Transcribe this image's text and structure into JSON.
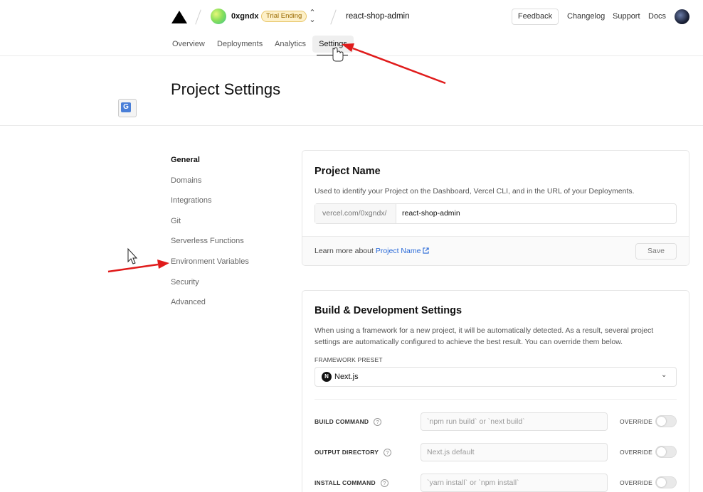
{
  "header": {
    "team_name": "0xgndx",
    "trial_badge": "Trial Ending",
    "switcher_icon": "chevron-up-down-icon",
    "project_name": "react-shop-admin",
    "feedback_label": "Feedback",
    "links": [
      "Changelog",
      "Support",
      "Docs"
    ]
  },
  "tabs": {
    "items": [
      "Overview",
      "Deployments",
      "Analytics",
      "Settings"
    ],
    "active": "Settings"
  },
  "page": {
    "title": "Project Settings"
  },
  "sidebar": {
    "items": [
      {
        "label": "General"
      },
      {
        "label": "Domains"
      },
      {
        "label": "Integrations"
      },
      {
        "label": "Git"
      },
      {
        "label": "Serverless Functions"
      },
      {
        "label": "Environment Variables"
      },
      {
        "label": "Security"
      },
      {
        "label": "Advanced"
      }
    ]
  },
  "project_name_card": {
    "title": "Project Name",
    "description": "Used to identify your Project on the Dashboard, Vercel CLI, and in the URL of your Deployments.",
    "url_prefix": "vercel.com/0xgndx/",
    "value": "react-shop-admin",
    "learn_prefix": "Learn more about",
    "learn_link": "Project Name",
    "save_label": "Save"
  },
  "build_card": {
    "title": "Build & Development Settings",
    "description_line1": "When using a framework for a new project, it will be automatically detected. As a result, several project",
    "description_line2": "settings are automatically configured to achieve the best result. You can override them below.",
    "framework_label": "FRAMEWORK PRESET",
    "framework_value": "Next.js",
    "override_label": "OVERRIDE",
    "rows": [
      {
        "label": "BUILD COMMAND",
        "placeholder": "`npm run build` or `next build`"
      },
      {
        "label": "OUTPUT DIRECTORY",
        "placeholder": "Next.js default"
      },
      {
        "label": "INSTALL COMMAND",
        "placeholder": "`yarn install` or `npm install`"
      }
    ]
  },
  "colors": {
    "link": "#2a6ad8",
    "annotation_arrow": "#e01b1b",
    "trial_badge_bg": "#fdf0c8"
  }
}
